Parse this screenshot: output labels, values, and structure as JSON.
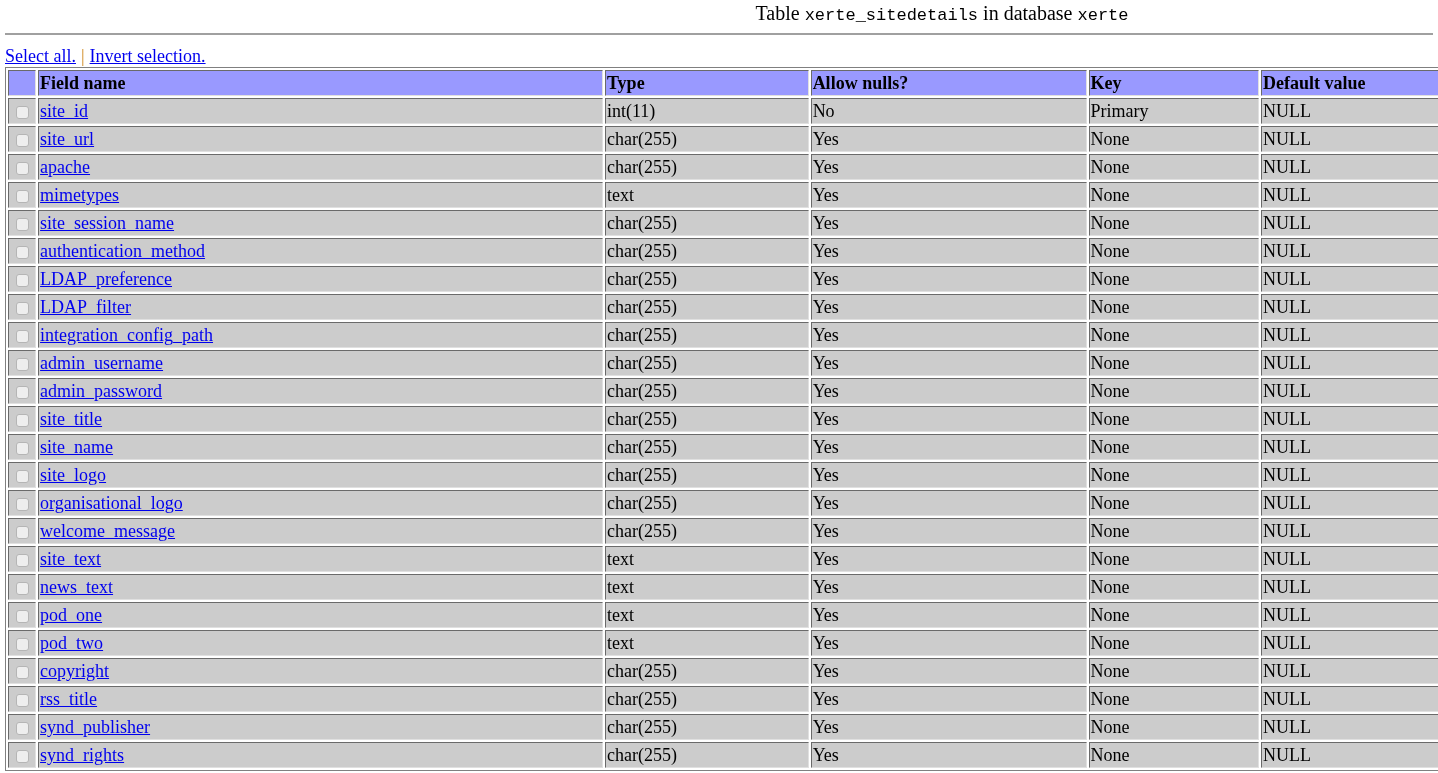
{
  "heading": {
    "prefix": "Table",
    "table_name": "xerte_sitedetails",
    "middle": "in database",
    "database_name": "xerte"
  },
  "selection_links": [
    {
      "label": "Select all."
    },
    {
      "label": "Invert selection."
    }
  ],
  "selection_separator": "|",
  "table": {
    "columns": [
      "Field name",
      "Type",
      "Allow nulls?",
      "Key",
      "Default value"
    ],
    "rows": [
      {
        "checked": false,
        "field": "site_id",
        "type": "int(11)",
        "nulls": "No",
        "key": "Primary",
        "default": "NULL"
      },
      {
        "checked": false,
        "field": "site_url",
        "type": "char(255)",
        "nulls": "Yes",
        "key": "None",
        "default": "NULL"
      },
      {
        "checked": false,
        "field": "apache",
        "type": "char(255)",
        "nulls": "Yes",
        "key": "None",
        "default": "NULL"
      },
      {
        "checked": false,
        "field": "mimetypes",
        "type": "text",
        "nulls": "Yes",
        "key": "None",
        "default": "NULL"
      },
      {
        "checked": false,
        "field": "site_session_name",
        "type": "char(255)",
        "nulls": "Yes",
        "key": "None",
        "default": "NULL"
      },
      {
        "checked": false,
        "field": "authentication_method",
        "type": "char(255)",
        "nulls": "Yes",
        "key": "None",
        "default": "NULL"
      },
      {
        "checked": false,
        "field": "LDAP_preference",
        "type": "char(255)",
        "nulls": "Yes",
        "key": "None",
        "default": "NULL"
      },
      {
        "checked": false,
        "field": "LDAP_filter",
        "type": "char(255)",
        "nulls": "Yes",
        "key": "None",
        "default": "NULL"
      },
      {
        "checked": false,
        "field": "integration_config_path",
        "type": "char(255)",
        "nulls": "Yes",
        "key": "None",
        "default": "NULL"
      },
      {
        "checked": false,
        "field": "admin_username",
        "type": "char(255)",
        "nulls": "Yes",
        "key": "None",
        "default": "NULL"
      },
      {
        "checked": false,
        "field": "admin_password",
        "type": "char(255)",
        "nulls": "Yes",
        "key": "None",
        "default": "NULL"
      },
      {
        "checked": false,
        "field": "site_title",
        "type": "char(255)",
        "nulls": "Yes",
        "key": "None",
        "default": "NULL"
      },
      {
        "checked": false,
        "field": "site_name",
        "type": "char(255)",
        "nulls": "Yes",
        "key": "None",
        "default": "NULL"
      },
      {
        "checked": false,
        "field": "site_logo",
        "type": "char(255)",
        "nulls": "Yes",
        "key": "None",
        "default": "NULL"
      },
      {
        "checked": false,
        "field": "organisational_logo",
        "type": "char(255)",
        "nulls": "Yes",
        "key": "None",
        "default": "NULL"
      },
      {
        "checked": false,
        "field": "welcome_message",
        "type": "char(255)",
        "nulls": "Yes",
        "key": "None",
        "default": "NULL"
      },
      {
        "checked": false,
        "field": "site_text",
        "type": "text",
        "nulls": "Yes",
        "key": "None",
        "default": "NULL"
      },
      {
        "checked": false,
        "field": "news_text",
        "type": "text",
        "nulls": "Yes",
        "key": "None",
        "default": "NULL"
      },
      {
        "checked": false,
        "field": "pod_one",
        "type": "text",
        "nulls": "Yes",
        "key": "None",
        "default": "NULL"
      },
      {
        "checked": false,
        "field": "pod_two",
        "type": "text",
        "nulls": "Yes",
        "key": "None",
        "default": "NULL"
      },
      {
        "checked": false,
        "field": "copyright",
        "type": "char(255)",
        "nulls": "Yes",
        "key": "None",
        "default": "NULL"
      },
      {
        "checked": false,
        "field": "rss_title",
        "type": "char(255)",
        "nulls": "Yes",
        "key": "None",
        "default": "NULL"
      },
      {
        "checked": false,
        "field": "synd_publisher",
        "type": "char(255)",
        "nulls": "Yes",
        "key": "None",
        "default": "NULL"
      },
      {
        "checked": false,
        "field": "synd_rights",
        "type": "char(255)",
        "nulls": "Yes",
        "key": "None",
        "default": "NULL"
      }
    ]
  }
}
